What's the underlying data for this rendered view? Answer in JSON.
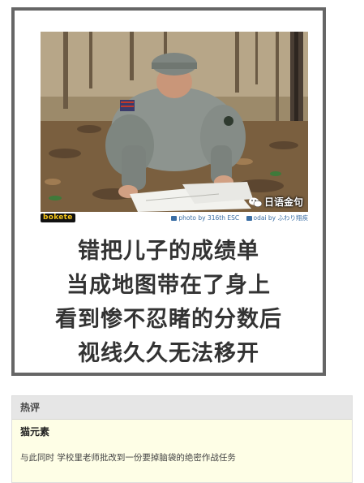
{
  "post": {
    "logo_text": "bokete",
    "photo_credit": "photo by 316th ESC",
    "odai_credit": "odai by ふわり翔疾",
    "watermark": "日语金句",
    "caption_lines": [
      "错把儿子的成绩单",
      "当成地图带在了身上",
      "看到惨不忍睹的分数后",
      "视线久久无法移开"
    ]
  },
  "comments": {
    "header": "热评",
    "items": [
      {
        "user": "猫元素",
        "text": "与此同时 学校里老师批改到一份要掉脑袋的绝密作战任务"
      }
    ]
  },
  "colors": {
    "frame_border": "#666666",
    "caption_text": "#333333",
    "comment_bg": "#fefee6",
    "header_bg": "#e6e6e6",
    "credit_link": "#3a6ea5"
  }
}
